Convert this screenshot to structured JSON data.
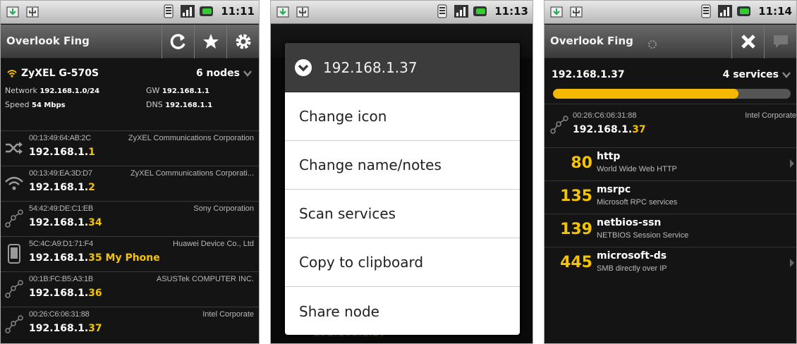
{
  "status": {
    "times": [
      "11:11",
      "11:13",
      "11:14"
    ]
  },
  "app": {
    "title": "Overlook Fing"
  },
  "network": {
    "ssid": "ZyXEL G-570S",
    "nodes": "6 nodes",
    "network_label": "Network",
    "network_value": "192.168.1.0/24",
    "gw_label": "GW",
    "gw_value": "192.168.1.1",
    "speed_label": "Speed",
    "speed_value": "54 Mbps",
    "dns_label": "DNS",
    "dns_value": "192.168.1.1"
  },
  "nodes": [
    {
      "mac": "00:13:49:64:AB:2C",
      "vendor": "ZyXEL Communications Corporation",
      "ip_prefix": "192.168.1.",
      "ip_suffix": "1",
      "name": "",
      "icon": "router-icon"
    },
    {
      "mac": "00:13:49:EA:3D:D7",
      "vendor": "ZyXEL Communications Corporati...",
      "ip_prefix": "192.168.1.",
      "ip_suffix": "2",
      "name": "",
      "icon": "wifi-icon"
    },
    {
      "mac": "54:42:49:DE:C1:EB",
      "vendor": "Sony Corporation",
      "ip_prefix": "192.168.1.",
      "ip_suffix": "34",
      "name": "",
      "icon": "network-node-icon"
    },
    {
      "mac": "5C:4C:A9:D1:71:F4",
      "vendor": "Huawei Device Co., Ltd",
      "ip_prefix": "192.168.1.",
      "ip_suffix": "35",
      "name": "My Phone",
      "icon": "phone-icon"
    },
    {
      "mac": "00:1B:FC:B5:A3:1B",
      "vendor": "ASUSTek COMPUTER INC.",
      "ip_prefix": "192.168.1.",
      "ip_suffix": "36",
      "name": "",
      "icon": "network-node-icon"
    },
    {
      "mac": "00:26:C6:06:31:88",
      "vendor": "Intel Corporate",
      "ip_prefix": "192.168.1.",
      "ip_suffix": "37",
      "name": "",
      "icon": "network-node-icon"
    }
  ],
  "dialog": {
    "title": "192.168.1.37",
    "items": [
      "Change icon",
      "Change name/notes",
      "Scan services",
      "Copy to clipboard",
      "Share node"
    ]
  },
  "background_hint": {
    "ip_prefix": "192.168.1.",
    "ip_suffix": "37"
  },
  "services": {
    "ip": "192.168.1.37",
    "count": "4 services",
    "progress": 0.78,
    "node": {
      "mac": "00:26:C6:06:31:88",
      "vendor": "Intel Corporate",
      "ip_prefix": "192.168.1.",
      "ip_suffix": "37"
    },
    "list": [
      {
        "port": "80",
        "name": "http",
        "desc": "World Wide Web HTTP",
        "chevron": true
      },
      {
        "port": "135",
        "name": "msrpc",
        "desc": "Microsoft RPC services",
        "chevron": false
      },
      {
        "port": "139",
        "name": "netbios-ssn",
        "desc": "NETBIOS Session Service",
        "chevron": false
      },
      {
        "port": "445",
        "name": "microsoft-ds",
        "desc": "SMB directly over IP",
        "chevron": true
      }
    ]
  },
  "colors": {
    "accent": "#f5c400",
    "background": "#141414",
    "titlebar": "#4a4a4a"
  }
}
